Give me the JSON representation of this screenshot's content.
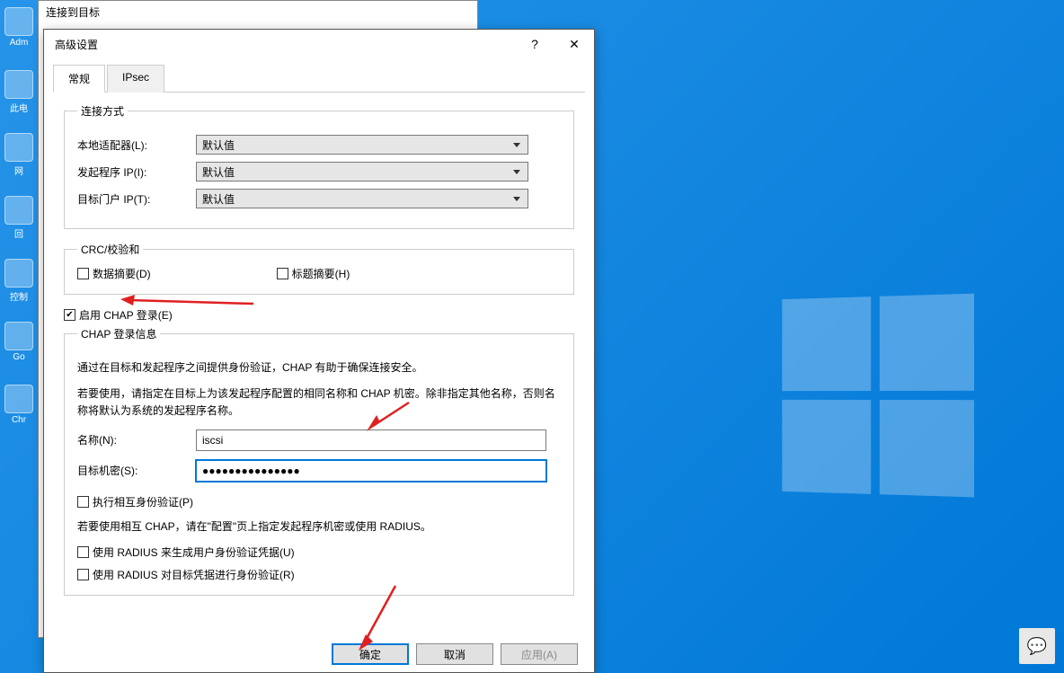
{
  "desktop": {
    "icons": [
      "Adm",
      "此电",
      "网",
      "回",
      "控制",
      "Go",
      "Chr"
    ]
  },
  "bg_window": {
    "title": "连接到目标"
  },
  "dialog": {
    "title": "高级设置",
    "help_char": "?",
    "close_char": "✕",
    "tabs": {
      "general": "常规",
      "ipsec": "IPsec"
    },
    "connection": {
      "legend": "连接方式",
      "local_adapter_label": "本地适配器(L):",
      "initiator_ip_label": "发起程序 IP(I):",
      "target_ip_label": "目标门户 IP(T):",
      "default_value": "默认值"
    },
    "crc": {
      "legend": "CRC/校验和",
      "data_digest": "数据摘要(D)",
      "header_digest": "标题摘要(H)"
    },
    "chap": {
      "enable_label": "启用 CHAP 登录(E)",
      "legend": "CHAP 登录信息",
      "desc1": "通过在目标和发起程序之间提供身份验证，CHAP 有助于确保连接安全。",
      "desc2": "若要使用，请指定在目标上为该发起程序配置的相同名称和 CHAP 机密。除非指定其他名称，否则名称将默认为系统的发起程序名称。",
      "name_label": "名称(N):",
      "name_value": "iscsi",
      "secret_label": "目标机密(S):",
      "secret_value": "●●●●●●●●●●●●●●●",
      "mutual_label": "执行相互身份验证(P)",
      "mutual_desc": "若要使用相互 CHAP，请在\"配置\"页上指定发起程序机密或使用 RADIUS。",
      "radius_gen": "使用 RADIUS 来生成用户身份验证凭据(U)",
      "radius_auth": "使用 RADIUS 对目标凭据进行身份验证(R)"
    },
    "buttons": {
      "ok": "确定",
      "cancel": "取消",
      "apply": "应用(A)"
    }
  }
}
